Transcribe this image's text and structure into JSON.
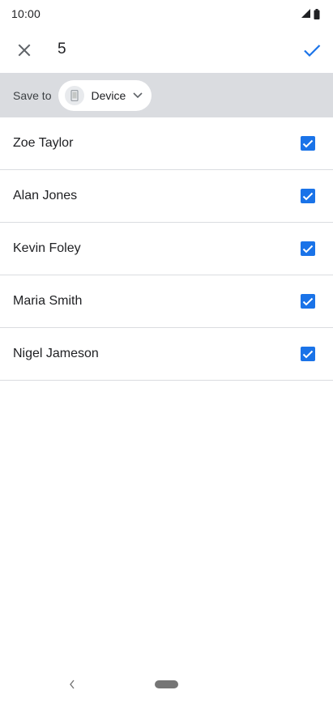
{
  "status_bar": {
    "time": "10:00",
    "icons": [
      "cell-signal-icon",
      "battery-icon"
    ]
  },
  "app_bar": {
    "selected_count": "5",
    "icons": [
      "close-icon",
      "check-icon"
    ]
  },
  "save_to": {
    "label": "Save to",
    "account": "Device",
    "icons": [
      "phone-icon",
      "chevron-down-icon"
    ]
  },
  "contacts": [
    {
      "name": "Zoe Taylor",
      "checked": true
    },
    {
      "name": "Alan Jones",
      "checked": true
    },
    {
      "name": "Kevin Foley",
      "checked": true
    },
    {
      "name": "Maria Smith",
      "checked": true
    },
    {
      "name": "Nigel Jameson",
      "checked": true
    }
  ],
  "colors": {
    "accent": "#1a73e8",
    "save_bar_bg": "#dadce0",
    "divider": "#dadce0"
  }
}
